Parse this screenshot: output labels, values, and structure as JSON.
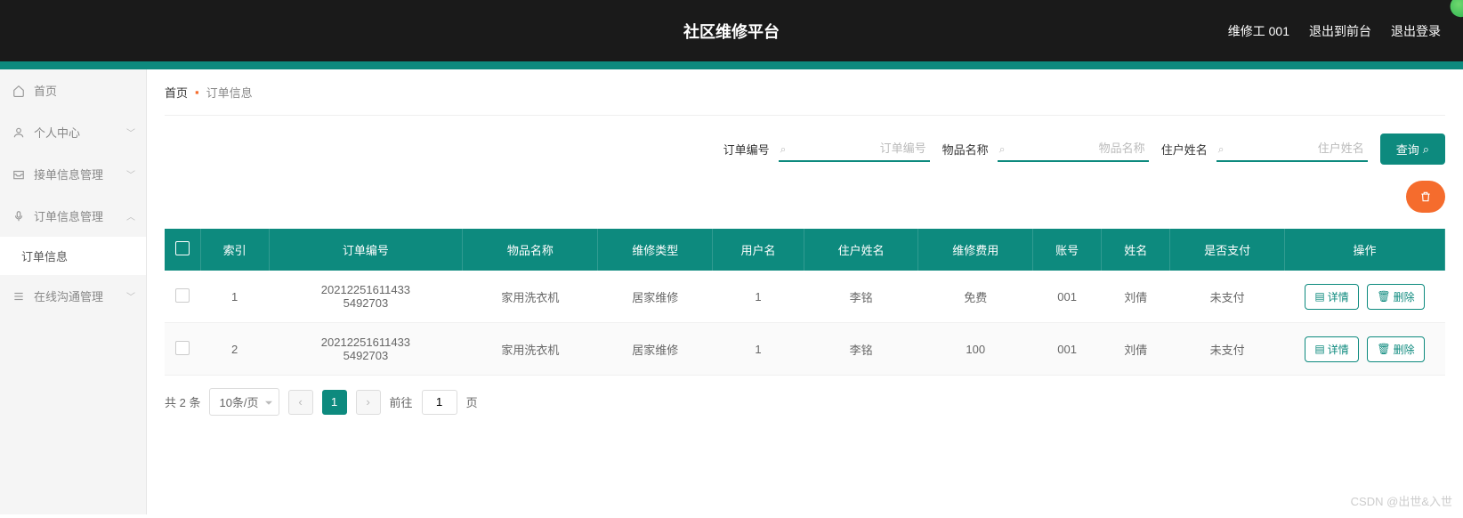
{
  "header": {
    "title": "社区维修平台",
    "user": "维修工 001",
    "exit_front": "退出到前台",
    "logout": "退出登录"
  },
  "sidebar": {
    "items": [
      {
        "icon": "home",
        "label": "首页",
        "chev": ""
      },
      {
        "icon": "user",
        "label": "个人中心",
        "chev": "down"
      },
      {
        "icon": "inbox",
        "label": "接单信息管理",
        "chev": "down"
      },
      {
        "icon": "mic",
        "label": "订单信息管理",
        "chev": "up"
      },
      {
        "icon": "comm",
        "label": "在线沟通管理",
        "chev": "down"
      }
    ],
    "sub_label": "订单信息"
  },
  "breadcrumb": {
    "home": "首页",
    "current": "订单信息"
  },
  "filters": {
    "f1": {
      "label": "订单编号",
      "placeholder": "订单编号"
    },
    "f2": {
      "label": "物品名称",
      "placeholder": "物品名称"
    },
    "f3": {
      "label": "住户姓名",
      "placeholder": "住户姓名"
    },
    "query": "查询"
  },
  "table": {
    "headers": [
      "",
      "索引",
      "订单编号",
      "物品名称",
      "维修类型",
      "用户名",
      "住户姓名",
      "维修费用",
      "账号",
      "姓名",
      "是否支付",
      "操作"
    ],
    "rows": [
      {
        "idx": "1",
        "order_no": "202122516114335492703",
        "item": "家用洗衣机",
        "type": "居家维修",
        "username": "1",
        "resident": "李铭",
        "fee": "免费",
        "account": "001",
        "name": "刘倩",
        "paid": "未支付"
      },
      {
        "idx": "2",
        "order_no": "202122516114335492703",
        "item": "家用洗衣机",
        "type": "居家维修",
        "username": "1",
        "resident": "李铭",
        "fee": "100",
        "account": "001",
        "name": "刘倩",
        "paid": "未支付"
      }
    ],
    "detail_label": "详情",
    "delete_label": "删除"
  },
  "pagination": {
    "total": "共 2 条",
    "page_size": "10条/页",
    "goto": "前往",
    "page_value": "1",
    "page_suffix": "页",
    "current": "1"
  },
  "watermark": "CSDN @出世&入世"
}
